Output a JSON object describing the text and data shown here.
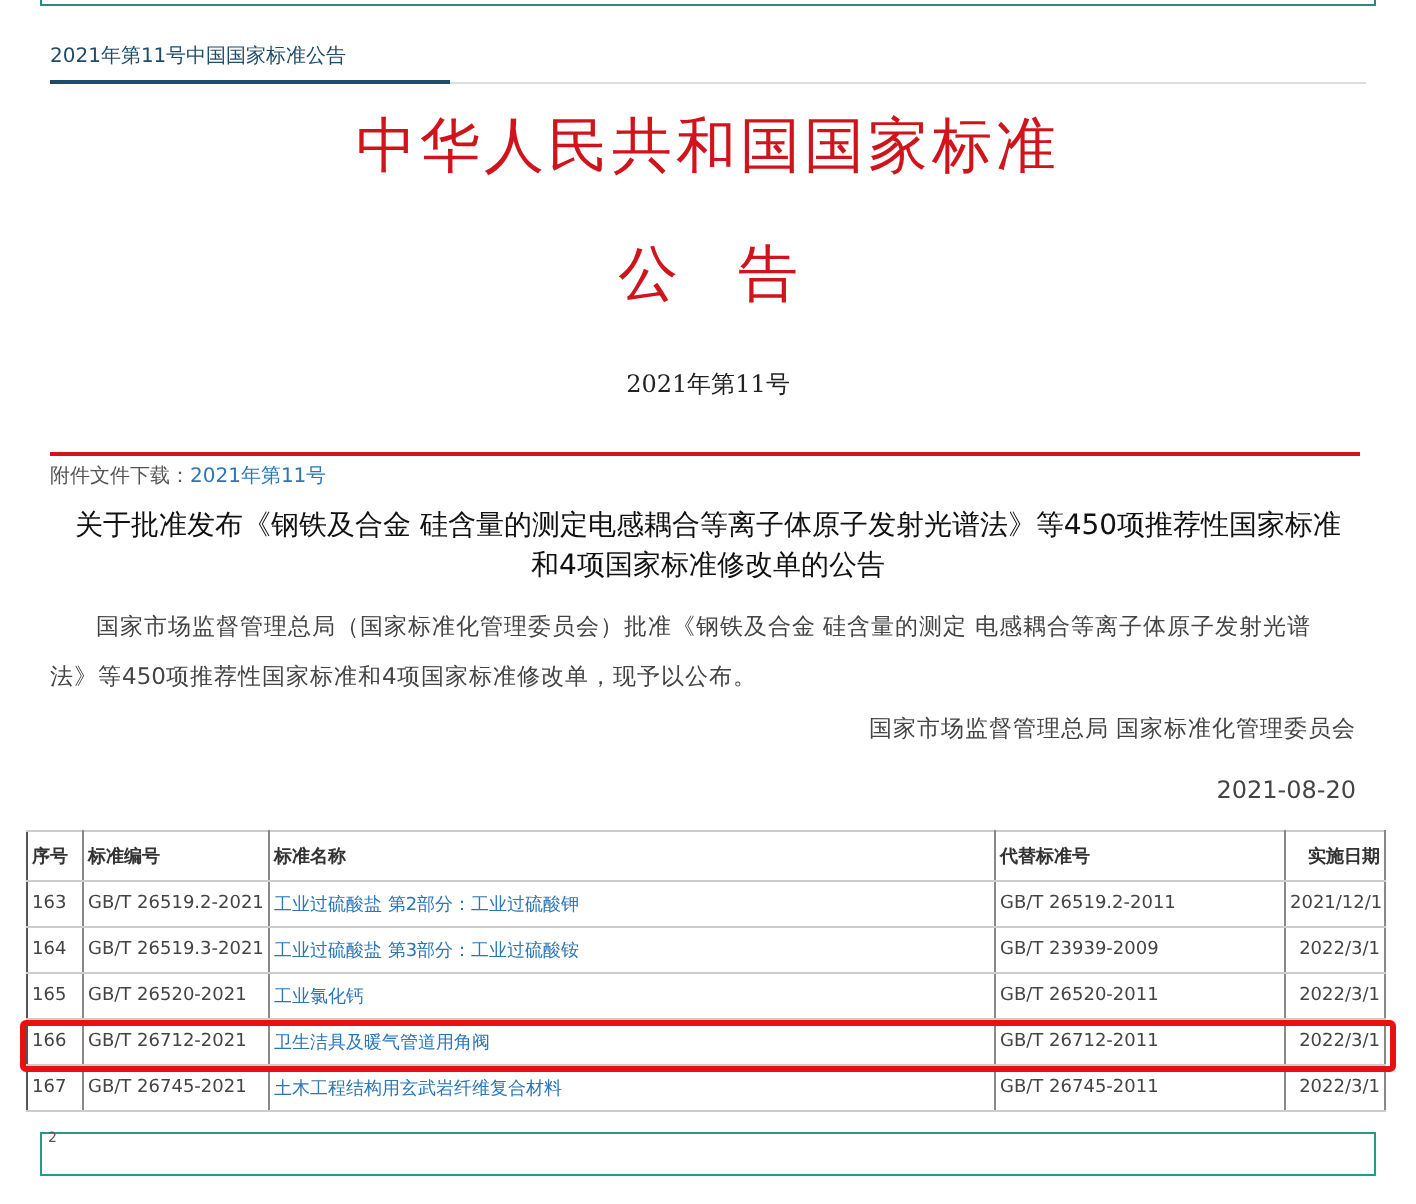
{
  "breadcrumb": "2021年第11号中国国家标准公告",
  "title": "中华人民共和国国家标准",
  "subtitle": "公　告",
  "issue": "2021年第11号",
  "attachment": {
    "label": "附件文件下载：",
    "link": "2021年第11号"
  },
  "headline": "关于批准发布《钢铁及合金 硅含量的测定电感耦合等离子体原子发射光谱法》等450项推荐性国家标准和4项国家标准修改单的公告",
  "body": "国家市场监督管理总局（国家标准化管理委员会）批准《钢铁及合金 硅含量的测定 电感耦合等离子体原子发射光谱法》等450项推荐性国家标准和4项国家标准修改单，现予以公布。",
  "signature": "国家市场监督管理总局 国家标准化管理委员会",
  "date": "2021-08-20",
  "table": {
    "columns": [
      "序号",
      "标准编号",
      "标准名称",
      "代替标准号",
      "实施日期"
    ],
    "rows": [
      {
        "cells": [
          "163",
          "GB/T 26519.2-2021",
          "工业过硫酸盐 第2部分：工业过硫酸钾",
          "GB/T 26519.2-2011",
          "2021/12/1"
        ],
        "highlighted": false
      },
      {
        "cells": [
          "164",
          "GB/T 26519.3-2021",
          "工业过硫酸盐 第3部分：工业过硫酸铵",
          "GB/T 23939-2009",
          "2022/3/1"
        ],
        "highlighted": false
      },
      {
        "cells": [
          "165",
          "GB/T 26520-2021",
          "工业氯化钙",
          "GB/T 26520-2011",
          "2022/3/1"
        ],
        "highlighted": false
      },
      {
        "cells": [
          "166",
          "GB/T 26712-2021",
          "卫生洁具及暖气管道用角阀",
          "GB/T 26712-2011",
          "2022/3/1"
        ],
        "highlighted": true
      },
      {
        "cells": [
          "167",
          "GB/T 26745-2021",
          "土木工程结构用玄武岩纤维复合材料",
          "GB/T 26745-2011",
          "2022/3/1"
        ],
        "highlighted": false
      }
    ]
  },
  "footer_box": "2"
}
